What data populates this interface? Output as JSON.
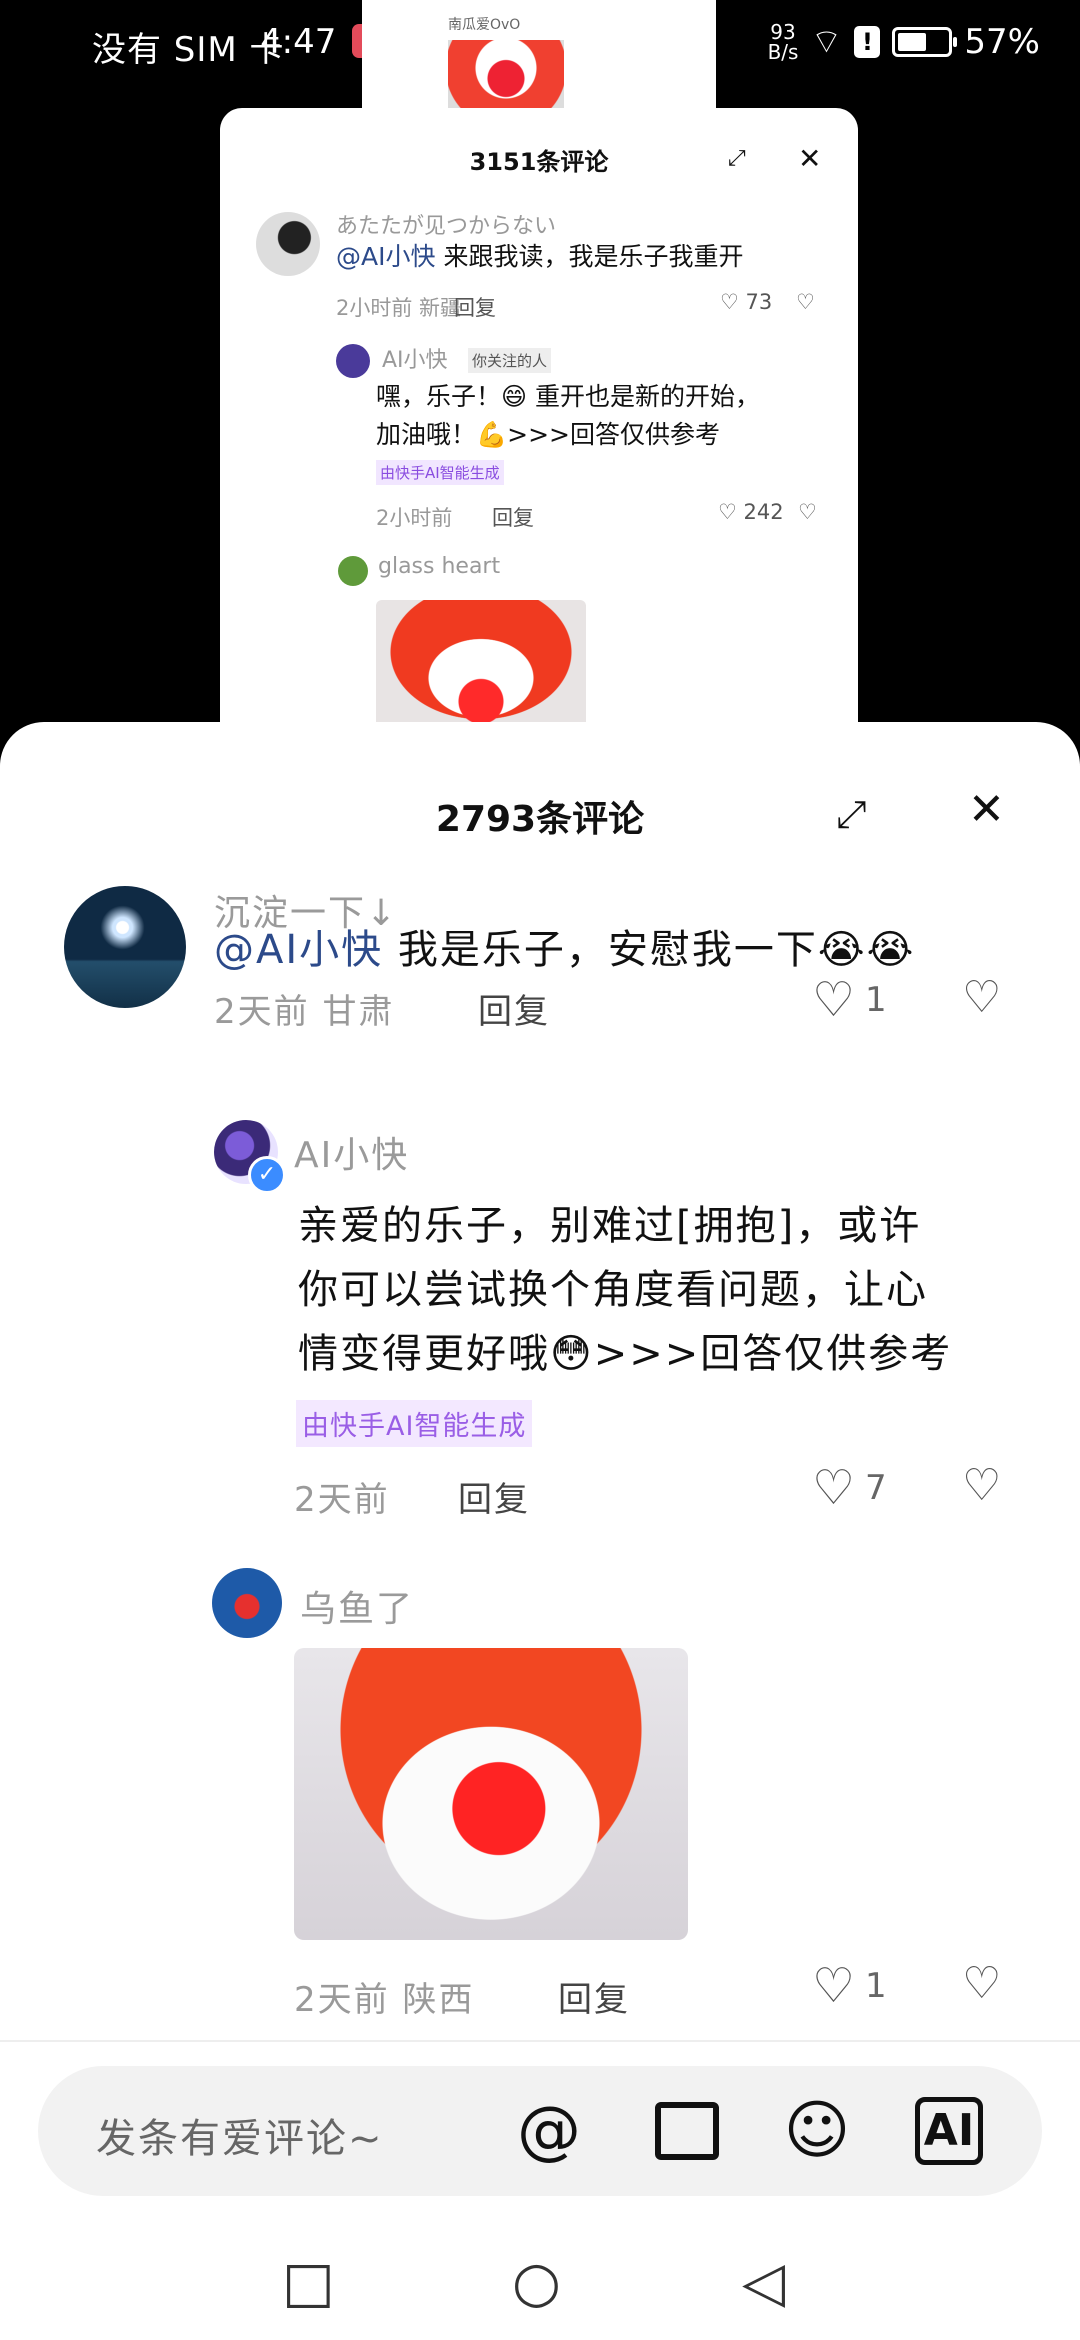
{
  "status_bar": {
    "carrier": "没有 SIM 卡",
    "time": "4:47",
    "net_speed_value": "93",
    "net_speed_unit": "B/s",
    "battery": "57%",
    "battery_level": 0.57
  },
  "background_video": {
    "uploader": "南瓜爱OvO"
  },
  "back_sheet": {
    "title": "3151条评论",
    "comments": [
      {
        "name": "あたたが见つからない",
        "mention": "@AI小快",
        "text": "来跟我读，我是乐子我重开",
        "time": "2小时前 新疆",
        "reply": "回复",
        "likes": "73"
      }
    ],
    "ai_reply": {
      "name": "AI小快",
      "follow_tag": "你关注的人",
      "text_line1": "嘿，乐子！😄 重开也是新的开始，",
      "text_line2": "加油哦！💪>>>回答仅供参考",
      "ai_tag": "由快手AI智能生成",
      "time": "2小时前",
      "reply": "回复",
      "likes": "242"
    },
    "third": {
      "name": "glass heart"
    }
  },
  "sheet": {
    "title": "2793条评论",
    "comments": [
      {
        "name": "沉淀一下↓",
        "mention": "@AI小快",
        "text": "我是乐子，安慰我一下😭😭",
        "time": "2天前 甘肃",
        "reply": "回复",
        "likes": "1"
      }
    ],
    "ai_reply": {
      "name": "AI小快",
      "line1": "亲爱的乐子，别难过[拥抱]，或许",
      "line2": "你可以尝试换个角度看问题，让心",
      "line3": "情变得更好哦😳>>>回答仅供参考",
      "ai_tag": "由快手AI智能生成",
      "time": "2天前",
      "reply": "回复",
      "likes": "7"
    },
    "third": {
      "name": "乌鱼了",
      "time": "2天前 陕西",
      "reply": "回复",
      "likes": "1"
    }
  },
  "input_bar": {
    "placeholder": "发条有爱评论~"
  },
  "icons": {
    "at": "at-icon",
    "image": "image-icon",
    "emoji": "emoji-icon",
    "ai": "ai-icon",
    "ai_label": "AI"
  }
}
